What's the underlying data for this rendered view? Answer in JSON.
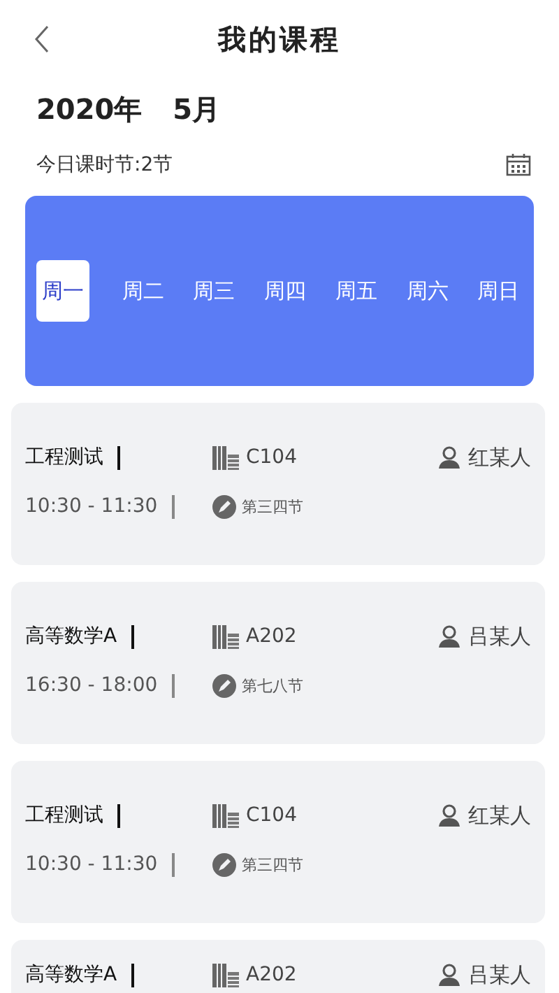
{
  "header": {
    "title": "我的课程"
  },
  "date": {
    "year": "2020年",
    "month": "5月"
  },
  "summary": {
    "text": "今日课时节:2节"
  },
  "weekdays": [
    {
      "label": "周一",
      "selected": true
    },
    {
      "label": "周二",
      "selected": false
    },
    {
      "label": "周三",
      "selected": false
    },
    {
      "label": "周四",
      "selected": false
    },
    {
      "label": "周五",
      "selected": false
    },
    {
      "label": "周六",
      "selected": false
    },
    {
      "label": "周日",
      "selected": false
    }
  ],
  "courses": [
    {
      "name": "工程测试",
      "room": "C104",
      "teacher": "红某人",
      "time": "10:30 - 11:30",
      "periods": "第三四节"
    },
    {
      "name": "高等数学A",
      "room": "A202",
      "teacher": "吕某人",
      "time": "16:30 - 18:00",
      "periods": "第七八节"
    },
    {
      "name": "工程测试",
      "room": "C104",
      "teacher": "红某人",
      "time": "10:30 - 11:30",
      "periods": "第三四节"
    },
    {
      "name": "高等数学A",
      "room": "A202",
      "teacher": "吕某人"
    }
  ]
}
